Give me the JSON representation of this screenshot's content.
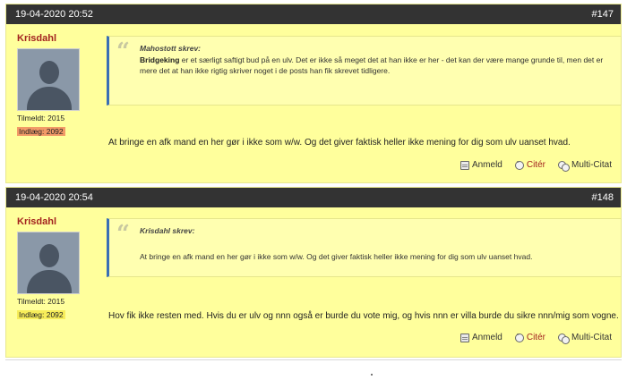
{
  "posts": [
    {
      "date": "19-04-2020 20:52",
      "number": "#147",
      "author": "Krisdahl",
      "member_since": "Tilmeldt: 2015",
      "post_count": "Indlæg: 2092",
      "quote": {
        "author": "Mahostott skrev:",
        "bold_name": "Bridgeking",
        "text": " er et særligt saftigt bud på en ulv. Det er ikke så meget det at han ikke er her - det kan der være mange grunde til, men det er mere det at han ikke rigtig skriver noget i de posts han fik skrevet tidligere."
      },
      "body": "At bringe en afk mand en her gør i ikke som w/w. Og det giver faktisk heller ikke mening for dig som ulv uanset hvad.",
      "actions": {
        "report": "Anmeld",
        "quote": "Citér",
        "multi": "Multi-Citat"
      }
    },
    {
      "date": "19-04-2020 20:54",
      "number": "#148",
      "author": "Krisdahl",
      "member_since": "Tilmeldt: 2015",
      "post_count": "Indlæg: 2092",
      "quote": {
        "author": "Krisdahl skrev:",
        "text": "At bringe en afk mand en her gør i ikke som w/w. Og det giver faktisk heller ikke mening for dig som ulv uanset hvad."
      },
      "body": "Hov fik ikke resten med. Hvis du er ulv og nnn også er burde du vote mig, og hvis nnn er villa burde du sikre nnn/mig som vogne.",
      "actions": {
        "report": "Anmeld",
        "quote": "Citér",
        "multi": "Multi-Citat"
      }
    }
  ],
  "colors": {
    "post_background": "#ffff9c",
    "header_background": "#333333",
    "author_name": "#a3231f",
    "quote_bar": "#3a6fb5",
    "count_highlight_first": "#f29a67",
    "count_highlight_second": "#f7ed5a"
  }
}
